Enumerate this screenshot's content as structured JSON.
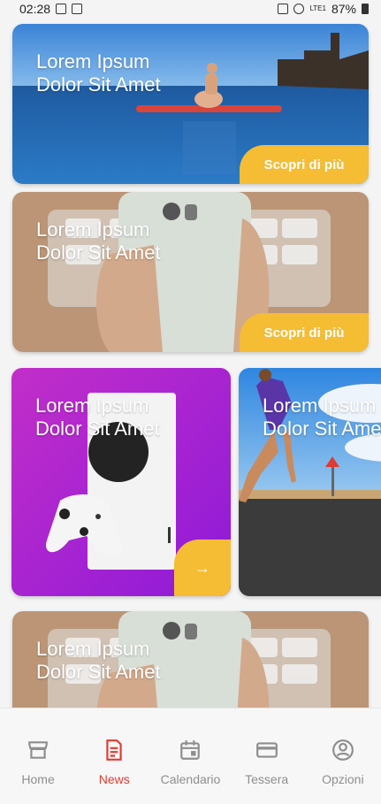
{
  "status_bar": {
    "time": "02:28",
    "network": "LTE1",
    "battery": "87%"
  },
  "colors": {
    "accent": "#f4bd34",
    "active_nav": "#e33a2f",
    "inactive_nav": "#8e8e8e"
  },
  "cards": [
    {
      "title": "Lorem Ipsum\nDolor Sit Amet",
      "cta": "Scopri di più"
    },
    {
      "title": "Lorem Ipsum\nDolor Sit Amet",
      "cta": "Scopri di più"
    },
    {
      "title": "Lorem Ipsum\nDolor Sit Amet",
      "cta": "→"
    },
    {
      "title": "Lorem Ipsum\nDolor Sit Amet"
    },
    {
      "title": "Lorem Ipsum\nDolor Sit Amet"
    }
  ],
  "nav": {
    "items": [
      {
        "label": "Home",
        "icon": "store-icon"
      },
      {
        "label": "News",
        "icon": "news-icon"
      },
      {
        "label": "Calendario",
        "icon": "calendar-icon"
      },
      {
        "label": "Tessera",
        "icon": "card-icon"
      },
      {
        "label": "Opzioni",
        "icon": "account-icon"
      }
    ],
    "active": "News"
  }
}
